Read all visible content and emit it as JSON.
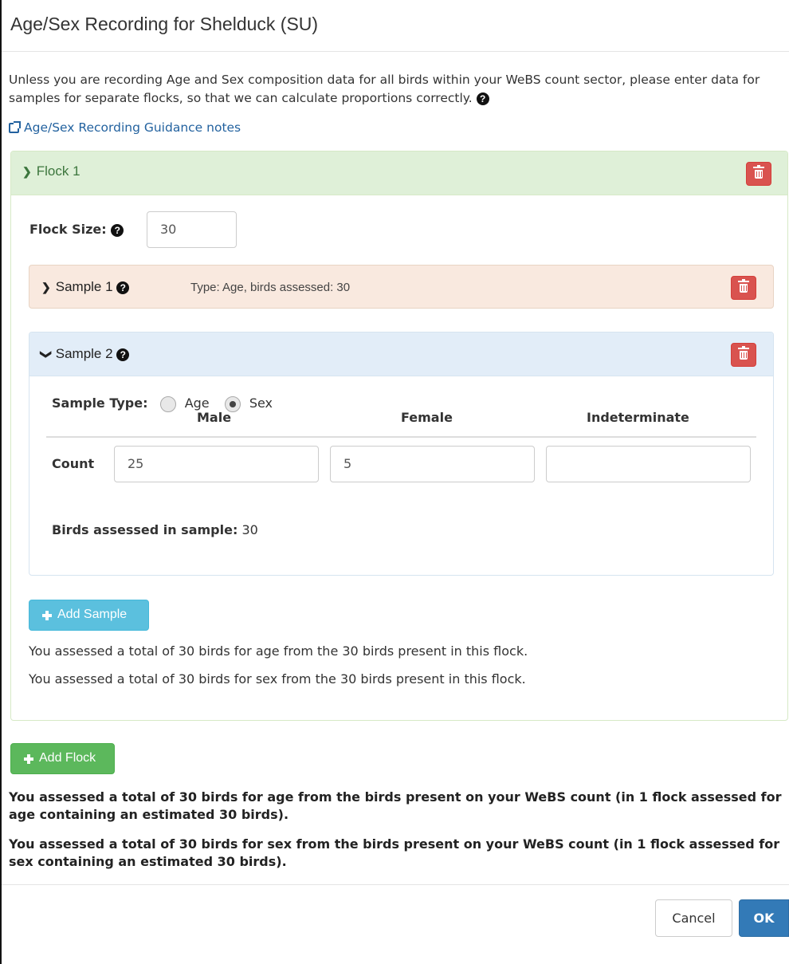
{
  "modal": {
    "title": "Age/Sex Recording for Shelduck (SU)",
    "intro": "Unless you are recording Age and Sex composition data for all birds within your WeBS count sector, please enter data for samples for separate flocks, so that we can calculate proportions correctly.",
    "help_glyph": "?",
    "guidance_link": "Age/Sex Recording Guidance notes"
  },
  "flock": {
    "title": "Flock 1",
    "size_label": "Flock Size:",
    "size_value": "30",
    "samples": [
      {
        "title": "Sample 1",
        "meta": "Type: Age, birds assessed: 30",
        "expanded": false
      },
      {
        "title": "Sample 2",
        "expanded": true,
        "type_label": "Sample Type:",
        "options": [
          "Age",
          "Sex"
        ],
        "selected": "Sex",
        "columns": [
          "Male",
          "Female",
          "Indeterminate"
        ],
        "row_label": "Count",
        "counts": [
          "25",
          "5",
          ""
        ],
        "assessed_label": "Birds assessed in sample:",
        "assessed_value": "30"
      }
    ],
    "add_sample": "Add Sample",
    "summary_age": "You assessed a total of 30 birds for age from the 30 birds present in this flock.",
    "summary_sex": "You assessed a total of 30 birds for sex from the 30 birds present in this flock."
  },
  "add_flock": "Add Flock",
  "totals": {
    "age": "You assessed a total of 30 birds for age from the birds present on your WeBS count (in 1 flock assessed for age containing an estimated 30 birds).",
    "sex": "You assessed a total of 30 birds for sex from the birds present on your WeBS count (in 1 flock assessed for sex containing an estimated 30 birds)."
  },
  "footer": {
    "cancel": "Cancel",
    "ok": "OK"
  },
  "colors": {
    "flock_heading": "#dff0d8",
    "sample1_heading": "#f9e9df",
    "sample2_heading": "#e2edf8",
    "danger": "#d9534f",
    "info": "#5bc0de",
    "success": "#5cb85c",
    "primary": "#337ab7",
    "link": "#23629f"
  }
}
